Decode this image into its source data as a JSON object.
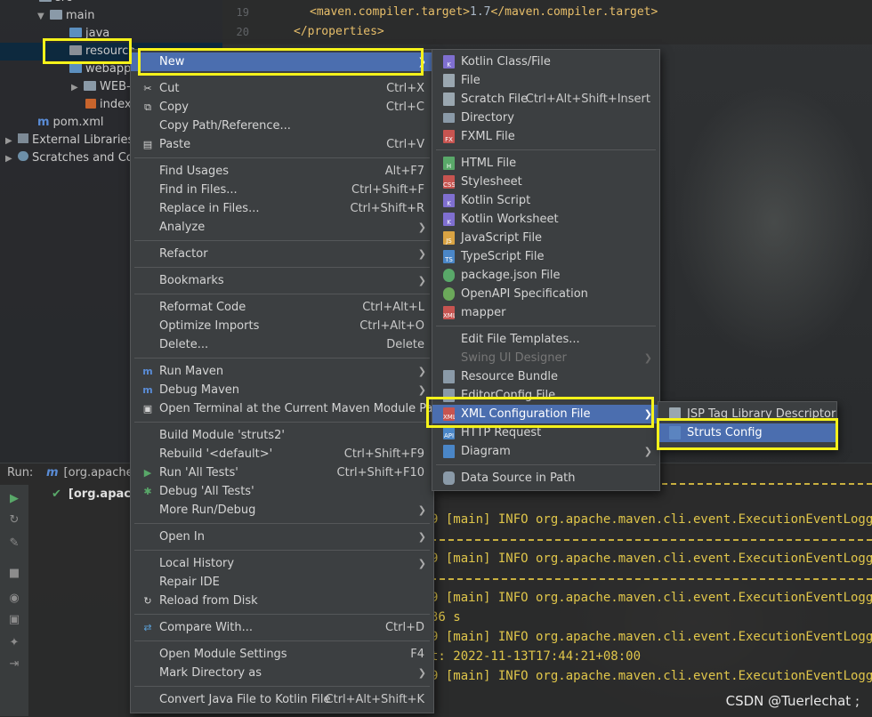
{
  "tree": {
    "src": "src",
    "main": "main",
    "java": "java",
    "resources": "resource",
    "webapp": "webapp",
    "web_inf": "WEB-",
    "index": "index",
    "pom": "pom.xml",
    "external": "External Libraries",
    "scratches": "Scratches and Co"
  },
  "editor": {
    "lines": [
      {
        "num": "19",
        "tag_open": "<maven.compiler.target>",
        "text": "1.7",
        "tag_close": "</maven.compiler.target>"
      },
      {
        "num": "20",
        "tag_open": "</properties>",
        "text": "",
        "tag_close": ""
      }
    ]
  },
  "run": {
    "label": "Run:",
    "tab": "[org.apache",
    "item": "[org.apach",
    "logs": [
      "9 [main] INFO org.apache.maven.cli.event.ExecutionEventLogger",
      "9 [main] INFO org.apache.maven.cli.event.ExecutionEventLogger",
      "9 [main] INFO org.apache.maven.cli.event.ExecutionEventLogger",
      "36 s",
      "9 [main] INFO org.apache.maven.cli.event.ExecutionEventLogger",
      "t: 2022-11-13T17:44:21+08:00",
      "9 [main] INFO org.apache.maven.cli.event.ExecutionEventLogger"
    ]
  },
  "context_menu": {
    "new": "New",
    "cut": {
      "label": "Cut",
      "shortcut": "Ctrl+X"
    },
    "copy": {
      "label": "Copy",
      "shortcut": "Ctrl+C"
    },
    "copy_path": "Copy Path/Reference...",
    "paste": {
      "label": "Paste",
      "shortcut": "Ctrl+V"
    },
    "find_usages": {
      "label": "Find Usages",
      "shortcut": "Alt+F7"
    },
    "find_in_files": {
      "label": "Find in Files...",
      "shortcut": "Ctrl+Shift+F"
    },
    "replace_in_files": {
      "label": "Replace in Files...",
      "shortcut": "Ctrl+Shift+R"
    },
    "analyze": "Analyze",
    "refactor": "Refactor",
    "bookmarks": "Bookmarks",
    "reformat": {
      "label": "Reformat Code",
      "shortcut": "Ctrl+Alt+L"
    },
    "optimize": {
      "label": "Optimize Imports",
      "shortcut": "Ctrl+Alt+O"
    },
    "delete": {
      "label": "Delete...",
      "shortcut": "Delete"
    },
    "run_maven": "Run Maven",
    "debug_maven": "Debug Maven",
    "open_terminal": "Open Terminal at the Current Maven Module Path",
    "build_module": "Build Module 'struts2'",
    "rebuild": {
      "label": "Rebuild '<default>'",
      "shortcut": "Ctrl+Shift+F9"
    },
    "run_tests": {
      "label": "Run 'All Tests'",
      "shortcut": "Ctrl+Shift+F10"
    },
    "debug_tests": "Debug 'All Tests'",
    "more_run": "More Run/Debug",
    "open_in": "Open In",
    "local_history": "Local History",
    "repair_ide": "Repair IDE",
    "reload": "Reload from Disk",
    "compare": {
      "label": "Compare With...",
      "shortcut": "Ctrl+D"
    },
    "module_settings": {
      "label": "Open Module Settings",
      "shortcut": "F4"
    },
    "mark_directory": "Mark Directory as",
    "convert": {
      "label": "Convert Java File to Kotlin File",
      "shortcut": "Ctrl+Alt+Shift+K"
    }
  },
  "new_menu": {
    "kotlin_class": "Kotlin Class/File",
    "file": "File",
    "scratch": {
      "label": "Scratch File",
      "shortcut": "Ctrl+Alt+Shift+Insert"
    },
    "directory": "Directory",
    "fxml": "FXML File",
    "html": "HTML File",
    "stylesheet": "Stylesheet",
    "kotlin_script": "Kotlin Script",
    "kotlin_worksheet": "Kotlin Worksheet",
    "javascript": "JavaScript File",
    "typescript": "TypeScript File",
    "package_json": "package.json File",
    "openapi": "OpenAPI Specification",
    "mapper": "mapper",
    "edit_templates": "Edit File Templates...",
    "swing_designer": "Swing UI Designer",
    "resource_bundle": "Resource Bundle",
    "editorconfig": "EditorConfig File",
    "xml_config": "XML Configuration File",
    "http_request": "HTTP Request",
    "diagram": "Diagram",
    "data_source": "Data Source in Path"
  },
  "xml_menu": {
    "jsp_tag": "JSP Tag Library Descriptor",
    "struts": "Struts Config"
  },
  "watermark": "CSDN @Tuerlechat ;",
  "colors": {
    "selection": "#4b6eaf",
    "highlight": "#f5f21a",
    "menu_bg": "#3c3f41"
  }
}
